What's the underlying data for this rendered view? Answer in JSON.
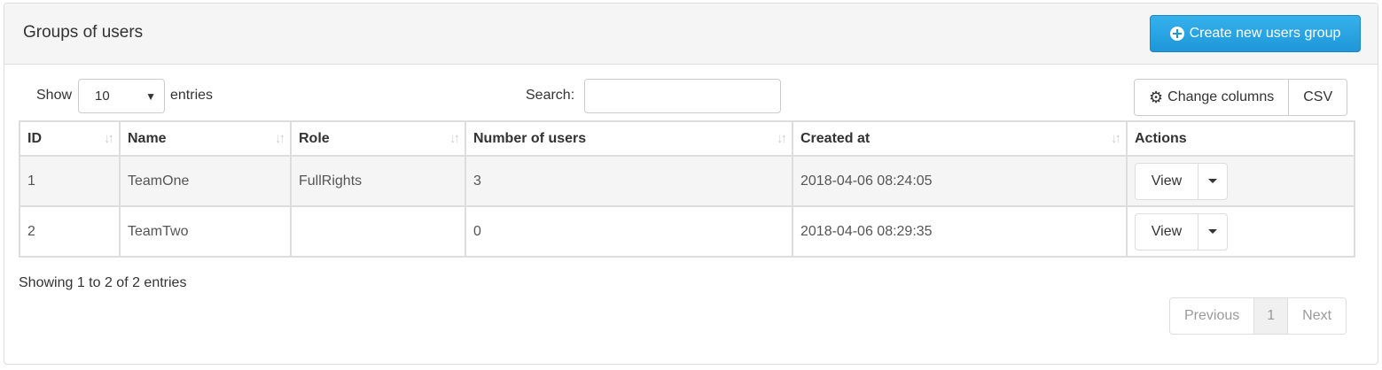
{
  "panel": {
    "title": "Groups of users",
    "create_button_label": "Create new users group"
  },
  "controls": {
    "show_label": "Show",
    "page_length": "10",
    "entries_label": "entries",
    "search_label": "Search:",
    "search_value": "",
    "change_columns_label": "Change columns",
    "csv_label": "CSV"
  },
  "table": {
    "columns": [
      "ID",
      "Name",
      "Role",
      "Number of users",
      "Created at",
      "Actions"
    ],
    "rows": [
      {
        "id": "1",
        "name": "TeamOne",
        "role": "FullRights",
        "users": "3",
        "created": "2018-04-06 08:24:05",
        "action": "View"
      },
      {
        "id": "2",
        "name": "TeamTwo",
        "role": "",
        "users": "0",
        "created": "2018-04-06 08:29:35",
        "action": "View"
      }
    ]
  },
  "footer": {
    "info": "Showing 1 to 2 of 2 entries",
    "previous": "Previous",
    "current_page": "1",
    "next": "Next"
  },
  "icons": {
    "create": "plus-circle-icon",
    "columns": "gear-icon",
    "sort": "sort-icon",
    "select": "caret-down-icon",
    "dropdown": "caret-down-icon"
  },
  "colors": {
    "primary_button": "#2ba6e1",
    "heading_background": "#f5f5f5",
    "border": "#dddddd"
  }
}
